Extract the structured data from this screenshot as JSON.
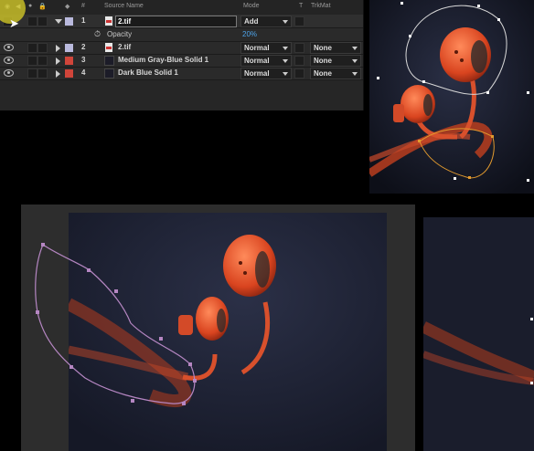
{
  "header": {
    "num_label": "#",
    "source_name_label": "Source Name",
    "mode_label": "Mode",
    "t_label": "T",
    "trkmat_label": "TrkMat"
  },
  "layers": [
    {
      "index": "1",
      "name": "2.tif",
      "mode": "Add",
      "trkmat": "",
      "color": "#b9b9dd",
      "expanded": true,
      "renaming": true
    },
    {
      "index": "2",
      "name": "2.tif",
      "mode": "Normal",
      "trkmat": "None",
      "color": "#b9b9dd"
    },
    {
      "index": "3",
      "name": "Medium Gray-Blue Solid 1",
      "mode": "Normal",
      "trkmat": "None",
      "color": "#d0453a"
    },
    {
      "index": "4",
      "name": "Dark Blue Solid 1",
      "mode": "Normal",
      "trkmat": "None",
      "color": "#d0453a"
    }
  ],
  "opacity_property": {
    "label": "Opacity",
    "value": "20%"
  },
  "colors": {
    "accent_value": "#4da3e8",
    "earphone": "#e0512e",
    "mask_path": "#b586c2",
    "mask_path_secondary": "#e29a2e",
    "highlight": "#dcd22a"
  }
}
